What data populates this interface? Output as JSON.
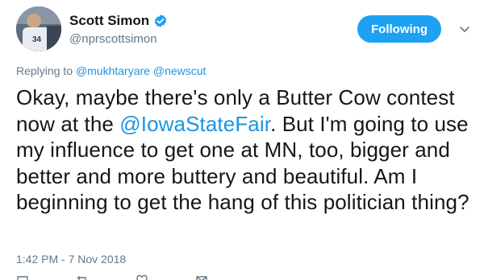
{
  "accent_color": "#1da1f2",
  "author": {
    "display_name": "Scott Simon",
    "handle": "@nprscottsimon",
    "verified": true,
    "avatar_jersey_number": "34"
  },
  "follow_button": {
    "label": "Following"
  },
  "menu": {
    "icon": "chevron-down-icon"
  },
  "reply_context": {
    "prefix": "Replying to",
    "mentions": [
      "@mukhtaryare",
      "@newscut"
    ]
  },
  "tweet": {
    "text_before_mention": "Okay, maybe there's only a Butter Cow contest now at the ",
    "mention": "@IowaStateFair",
    "text_after_mention": ". But I'm going to use my influence to get one at MN, too, bigger and better and more buttery and beautiful. Am I beginning to get the hang of this politician thing?",
    "timestamp": "1:42 PM - 7 Nov 2018"
  },
  "actions": {
    "icons": [
      "reply-icon",
      "retweet-icon",
      "like-icon",
      "message-icon"
    ]
  }
}
